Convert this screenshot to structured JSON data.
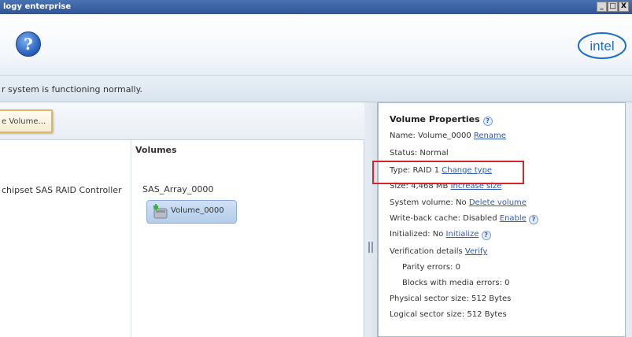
{
  "window": {
    "title": "logy enterprise",
    "buttons": [
      "_",
      "□",
      "X"
    ]
  },
  "header": {
    "help_icon_text": "?",
    "logo": "intel"
  },
  "status": {
    "message": "r system is functioning normally."
  },
  "toolbar": {
    "create_volume_label": "e Volume..."
  },
  "tree": {
    "controller": "chipset SAS RAID Controller",
    "volumes_heading": "Volumes",
    "array_name": "SAS_Array_0000",
    "volume_name": "Volume_0000"
  },
  "properties": {
    "title": "Volume Properties",
    "name_label": "Name: Volume_0000",
    "rename_link": "Rename",
    "status": "Status: Normal",
    "type_label": "Type: RAID 1",
    "change_type_link": "Change type",
    "size_label": "Size: 4,468 MB",
    "increase_size_link": "Increase size",
    "system_volume_label": "System volume: No",
    "delete_volume_link": "Delete volume",
    "write_back_label": "Write-back cache: Disabled",
    "enable_link": "Enable",
    "initialized_label": "Initialized: No",
    "initialize_link": "Initialize",
    "verification_label": "Verification details",
    "verify_link": "Verify",
    "parity_errors": "Parity errors: 0",
    "blocks_errors": "Blocks with media errors: 0",
    "physical_sector": "Physical sector size: 512 Bytes",
    "logical_sector": "Logical sector size: 512 Bytes"
  },
  "colors": {
    "highlight": "#d6242e",
    "link": "#2f5bb0",
    "titlebar": "#2f5597"
  }
}
